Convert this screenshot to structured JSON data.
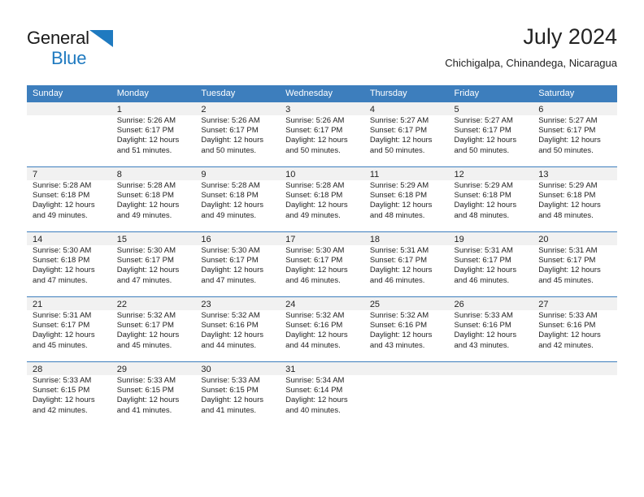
{
  "brand": {
    "name_part1": "General",
    "name_part2": "Blue",
    "triangle_color": "#1f7ac0"
  },
  "header": {
    "title": "July 2024",
    "subtitle": "Chichigalpa, Chinandega, Nicaragua"
  },
  "theme": {
    "header_blue": "#3d7ebd",
    "cell_band": "#f1f1f1",
    "text": "#222222"
  },
  "calendar": {
    "weekdays": [
      "Sunday",
      "Monday",
      "Tuesday",
      "Wednesday",
      "Thursday",
      "Friday",
      "Saturday"
    ],
    "weeks": [
      [
        {
          "day": "",
          "sunrise": "",
          "sunset": "",
          "daylight_line1": "",
          "daylight_line2": ""
        },
        {
          "day": "1",
          "sunrise": "Sunrise: 5:26 AM",
          "sunset": "Sunset: 6:17 PM",
          "daylight_line1": "Daylight: 12 hours",
          "daylight_line2": "and 51 minutes."
        },
        {
          "day": "2",
          "sunrise": "Sunrise: 5:26 AM",
          "sunset": "Sunset: 6:17 PM",
          "daylight_line1": "Daylight: 12 hours",
          "daylight_line2": "and 50 minutes."
        },
        {
          "day": "3",
          "sunrise": "Sunrise: 5:26 AM",
          "sunset": "Sunset: 6:17 PM",
          "daylight_line1": "Daylight: 12 hours",
          "daylight_line2": "and 50 minutes."
        },
        {
          "day": "4",
          "sunrise": "Sunrise: 5:27 AM",
          "sunset": "Sunset: 6:17 PM",
          "daylight_line1": "Daylight: 12 hours",
          "daylight_line2": "and 50 minutes."
        },
        {
          "day": "5",
          "sunrise": "Sunrise: 5:27 AM",
          "sunset": "Sunset: 6:17 PM",
          "daylight_line1": "Daylight: 12 hours",
          "daylight_line2": "and 50 minutes."
        },
        {
          "day": "6",
          "sunrise": "Sunrise: 5:27 AM",
          "sunset": "Sunset: 6:17 PM",
          "daylight_line1": "Daylight: 12 hours",
          "daylight_line2": "and 50 minutes."
        }
      ],
      [
        {
          "day": "7",
          "sunrise": "Sunrise: 5:28 AM",
          "sunset": "Sunset: 6:18 PM",
          "daylight_line1": "Daylight: 12 hours",
          "daylight_line2": "and 49 minutes."
        },
        {
          "day": "8",
          "sunrise": "Sunrise: 5:28 AM",
          "sunset": "Sunset: 6:18 PM",
          "daylight_line1": "Daylight: 12 hours",
          "daylight_line2": "and 49 minutes."
        },
        {
          "day": "9",
          "sunrise": "Sunrise: 5:28 AM",
          "sunset": "Sunset: 6:18 PM",
          "daylight_line1": "Daylight: 12 hours",
          "daylight_line2": "and 49 minutes."
        },
        {
          "day": "10",
          "sunrise": "Sunrise: 5:28 AM",
          "sunset": "Sunset: 6:18 PM",
          "daylight_line1": "Daylight: 12 hours",
          "daylight_line2": "and 49 minutes."
        },
        {
          "day": "11",
          "sunrise": "Sunrise: 5:29 AM",
          "sunset": "Sunset: 6:18 PM",
          "daylight_line1": "Daylight: 12 hours",
          "daylight_line2": "and 48 minutes."
        },
        {
          "day": "12",
          "sunrise": "Sunrise: 5:29 AM",
          "sunset": "Sunset: 6:18 PM",
          "daylight_line1": "Daylight: 12 hours",
          "daylight_line2": "and 48 minutes."
        },
        {
          "day": "13",
          "sunrise": "Sunrise: 5:29 AM",
          "sunset": "Sunset: 6:18 PM",
          "daylight_line1": "Daylight: 12 hours",
          "daylight_line2": "and 48 minutes."
        }
      ],
      [
        {
          "day": "14",
          "sunrise": "Sunrise: 5:30 AM",
          "sunset": "Sunset: 6:18 PM",
          "daylight_line1": "Daylight: 12 hours",
          "daylight_line2": "and 47 minutes."
        },
        {
          "day": "15",
          "sunrise": "Sunrise: 5:30 AM",
          "sunset": "Sunset: 6:17 PM",
          "daylight_line1": "Daylight: 12 hours",
          "daylight_line2": "and 47 minutes."
        },
        {
          "day": "16",
          "sunrise": "Sunrise: 5:30 AM",
          "sunset": "Sunset: 6:17 PM",
          "daylight_line1": "Daylight: 12 hours",
          "daylight_line2": "and 47 minutes."
        },
        {
          "day": "17",
          "sunrise": "Sunrise: 5:30 AM",
          "sunset": "Sunset: 6:17 PM",
          "daylight_line1": "Daylight: 12 hours",
          "daylight_line2": "and 46 minutes."
        },
        {
          "day": "18",
          "sunrise": "Sunrise: 5:31 AM",
          "sunset": "Sunset: 6:17 PM",
          "daylight_line1": "Daylight: 12 hours",
          "daylight_line2": "and 46 minutes."
        },
        {
          "day": "19",
          "sunrise": "Sunrise: 5:31 AM",
          "sunset": "Sunset: 6:17 PM",
          "daylight_line1": "Daylight: 12 hours",
          "daylight_line2": "and 46 minutes."
        },
        {
          "day": "20",
          "sunrise": "Sunrise: 5:31 AM",
          "sunset": "Sunset: 6:17 PM",
          "daylight_line1": "Daylight: 12 hours",
          "daylight_line2": "and 45 minutes."
        }
      ],
      [
        {
          "day": "21",
          "sunrise": "Sunrise: 5:31 AM",
          "sunset": "Sunset: 6:17 PM",
          "daylight_line1": "Daylight: 12 hours",
          "daylight_line2": "and 45 minutes."
        },
        {
          "day": "22",
          "sunrise": "Sunrise: 5:32 AM",
          "sunset": "Sunset: 6:17 PM",
          "daylight_line1": "Daylight: 12 hours",
          "daylight_line2": "and 45 minutes."
        },
        {
          "day": "23",
          "sunrise": "Sunrise: 5:32 AM",
          "sunset": "Sunset: 6:16 PM",
          "daylight_line1": "Daylight: 12 hours",
          "daylight_line2": "and 44 minutes."
        },
        {
          "day": "24",
          "sunrise": "Sunrise: 5:32 AM",
          "sunset": "Sunset: 6:16 PM",
          "daylight_line1": "Daylight: 12 hours",
          "daylight_line2": "and 44 minutes."
        },
        {
          "day": "25",
          "sunrise": "Sunrise: 5:32 AM",
          "sunset": "Sunset: 6:16 PM",
          "daylight_line1": "Daylight: 12 hours",
          "daylight_line2": "and 43 minutes."
        },
        {
          "day": "26",
          "sunrise": "Sunrise: 5:33 AM",
          "sunset": "Sunset: 6:16 PM",
          "daylight_line1": "Daylight: 12 hours",
          "daylight_line2": "and 43 minutes."
        },
        {
          "day": "27",
          "sunrise": "Sunrise: 5:33 AM",
          "sunset": "Sunset: 6:16 PM",
          "daylight_line1": "Daylight: 12 hours",
          "daylight_line2": "and 42 minutes."
        }
      ],
      [
        {
          "day": "28",
          "sunrise": "Sunrise: 5:33 AM",
          "sunset": "Sunset: 6:15 PM",
          "daylight_line1": "Daylight: 12 hours",
          "daylight_line2": "and 42 minutes."
        },
        {
          "day": "29",
          "sunrise": "Sunrise: 5:33 AM",
          "sunset": "Sunset: 6:15 PM",
          "daylight_line1": "Daylight: 12 hours",
          "daylight_line2": "and 41 minutes."
        },
        {
          "day": "30",
          "sunrise": "Sunrise: 5:33 AM",
          "sunset": "Sunset: 6:15 PM",
          "daylight_line1": "Daylight: 12 hours",
          "daylight_line2": "and 41 minutes."
        },
        {
          "day": "31",
          "sunrise": "Sunrise: 5:34 AM",
          "sunset": "Sunset: 6:14 PM",
          "daylight_line1": "Daylight: 12 hours",
          "daylight_line2": "and 40 minutes."
        },
        {
          "day": "",
          "sunrise": "",
          "sunset": "",
          "daylight_line1": "",
          "daylight_line2": ""
        },
        {
          "day": "",
          "sunrise": "",
          "sunset": "",
          "daylight_line1": "",
          "daylight_line2": ""
        },
        {
          "day": "",
          "sunrise": "",
          "sunset": "",
          "daylight_line1": "",
          "daylight_line2": ""
        }
      ]
    ]
  }
}
